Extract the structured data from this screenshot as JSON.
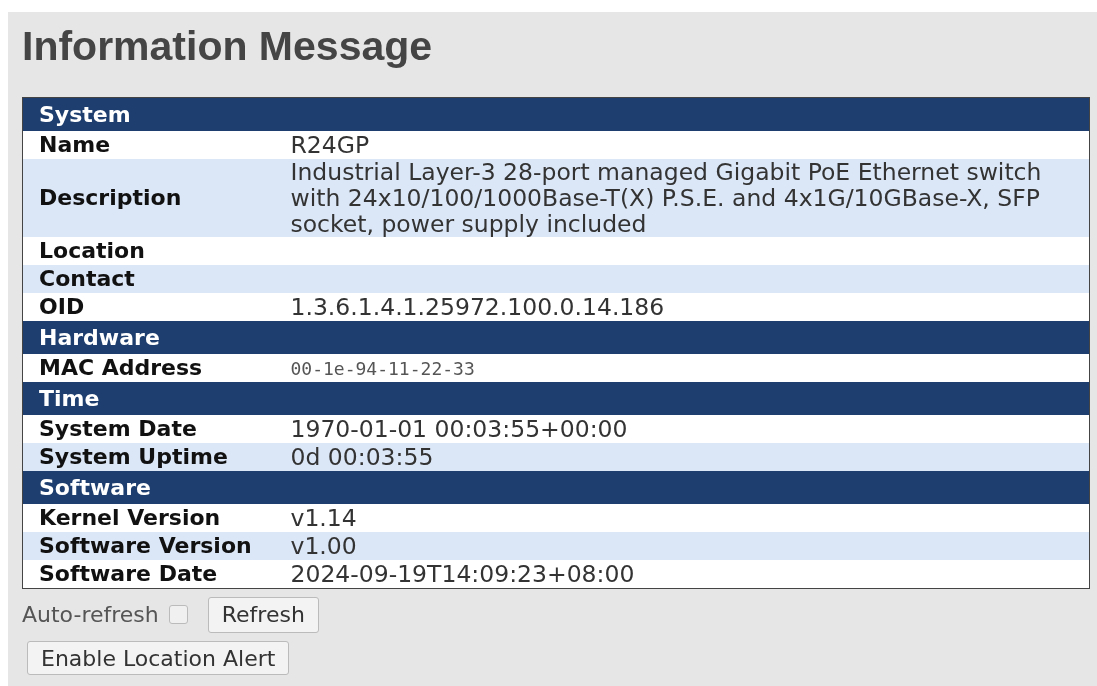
{
  "title": "Information Message",
  "sections": [
    {
      "title": "System",
      "rows": [
        {
          "label": "Name",
          "value": "R24GP",
          "kind": "text"
        },
        {
          "label": "Description",
          "value": "Industrial Layer-3 28-port managed Gigabit PoE Ethernet switch with 24x10/100/1000Base-T(X) P.S.E. and 4x1G/10GBase-X, SFP socket, power supply included",
          "kind": "text"
        },
        {
          "label": "Location"
        },
        {
          "label": "Contact"
        },
        {
          "label": "OID",
          "value": "1.3.6.1.4.1.25972.100.0.14.186",
          "kind": "text"
        }
      ]
    },
    {
      "title": "Hardware",
      "rows": [
        {
          "label": "MAC Address",
          "value": "00-1e-94-11-22-33",
          "kind": "mono"
        }
      ]
    },
    {
      "title": "Time",
      "rows": [
        {
          "label": "System Date",
          "value": "1970-01-01 00:03:55+00:00",
          "kind": "text"
        },
        {
          "label": "System Uptime",
          "value": "0d 00:03:55",
          "kind": "text"
        }
      ]
    },
    {
      "title": "Software",
      "rows": [
        {
          "label": "Kernel Version",
          "value": "v1.14",
          "kind": "text"
        },
        {
          "label": "Software Version",
          "value": "v1.00",
          "kind": "text"
        },
        {
          "label": "Software Date",
          "value": "2024-09-19T14:09:23+08:00",
          "kind": "text"
        }
      ]
    }
  ],
  "auto_refresh": {
    "label": "Auto-refresh",
    "checked": false
  },
  "refresh_button": "Refresh",
  "location_button": "Enable Location Alert"
}
